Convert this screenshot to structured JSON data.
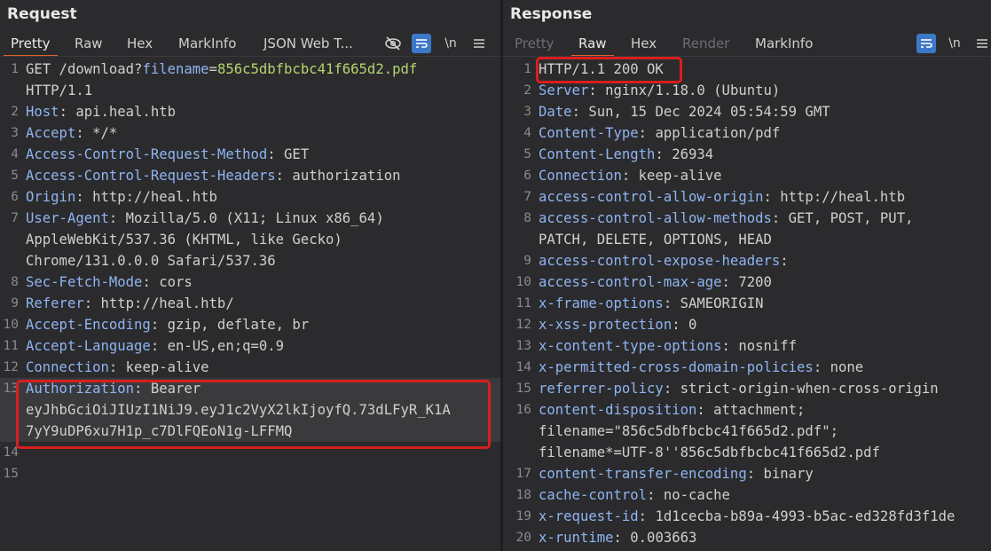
{
  "request": {
    "title": "Request",
    "tabs": [
      "Pretty",
      "Raw",
      "Hex",
      "MarkInfo",
      "JSON Web T..."
    ],
    "active_tab": "Pretty",
    "lines": [
      {
        "n": "1",
        "key": "GET /download?",
        "param": "filename",
        "eq": "=",
        "pval": "856c5dbfbcbc41f665d2.pdf",
        "rest": ""
      },
      {
        "n": "",
        "text": "HTTP/1.1"
      },
      {
        "n": "2",
        "key": "Host",
        "val": ": api.heal.htb"
      },
      {
        "n": "3",
        "key": "Accept",
        "val": ": */*"
      },
      {
        "n": "4",
        "key": "Access-Control-Request-Method",
        "val": ": GET"
      },
      {
        "n": "5",
        "key": "Access-Control-Request-Headers",
        "val": ": authorization"
      },
      {
        "n": "6",
        "key": "Origin",
        "val": ": http://heal.htb"
      },
      {
        "n": "7",
        "key": "User-Agent",
        "val": ": Mozilla/5.0 (X11; Linux x86_64)"
      },
      {
        "n": "",
        "text": "AppleWebKit/537.36 (KHTML, like Gecko)"
      },
      {
        "n": "",
        "text": "Chrome/131.0.0.0 Safari/537.36"
      },
      {
        "n": "8",
        "key": "Sec-Fetch-Mode",
        "val": ": cors"
      },
      {
        "n": "9",
        "key": "Referer",
        "val": ": http://heal.htb/"
      },
      {
        "n": "10",
        "key": "Accept-Encoding",
        "val": ": gzip, deflate, br"
      },
      {
        "n": "11",
        "key": "Accept-Language",
        "val": ": en-US,en;q=0.9"
      },
      {
        "n": "12",
        "key": "Connection",
        "val": ": keep-alive"
      },
      {
        "n": "13",
        "key": "Authorization",
        "val": ": Bearer"
      },
      {
        "n": "",
        "text": "eyJhbGciOiJIUzI1NiJ9.eyJ1c2VyX2lkIjoyfQ.73dLFyR_K1A"
      },
      {
        "n": "",
        "text": "7yY9uDP6xu7H1p_c7DlFQEoN1g-LFFMQ"
      },
      {
        "n": "14",
        "text": ""
      },
      {
        "n": "15",
        "text": ""
      }
    ]
  },
  "response": {
    "title": "Response",
    "tabs": [
      "Pretty",
      "Raw",
      "Hex",
      "Render",
      "MarkInfo"
    ],
    "active_tab": "Raw",
    "lines": [
      {
        "n": "1",
        "text": "HTTP/1.1 200 OK"
      },
      {
        "n": "2",
        "key": "Server",
        "val": ": nginx/1.18.0 (Ubuntu)"
      },
      {
        "n": "3",
        "key": "Date",
        "val": ": Sun, 15 Dec 2024 05:54:59 GMT"
      },
      {
        "n": "4",
        "key": "Content-Type",
        "val": ": application/pdf"
      },
      {
        "n": "5",
        "key": "Content-Length",
        "val": ": 26934"
      },
      {
        "n": "6",
        "key": "Connection",
        "val": ": keep-alive"
      },
      {
        "n": "7",
        "key": "access-control-allow-origin",
        "val": ": http://heal.htb"
      },
      {
        "n": "8",
        "key": "access-control-allow-methods",
        "val": ": GET, POST, PUT,"
      },
      {
        "n": "",
        "text": "PATCH, DELETE, OPTIONS, HEAD"
      },
      {
        "n": "9",
        "key": "access-control-expose-headers",
        "val": ":"
      },
      {
        "n": "10",
        "key": "access-control-max-age",
        "val": ": 7200"
      },
      {
        "n": "11",
        "key": "x-frame-options",
        "val": ": SAMEORIGIN"
      },
      {
        "n": "12",
        "key": "x-xss-protection",
        "val": ": 0"
      },
      {
        "n": "13",
        "key": "x-content-type-options",
        "val": ": nosniff"
      },
      {
        "n": "14",
        "key": "x-permitted-cross-domain-policies",
        "val": ": none"
      },
      {
        "n": "15",
        "key": "referrer-policy",
        "val": ": strict-origin-when-cross-origin"
      },
      {
        "n": "16",
        "key": "content-disposition",
        "val": ": attachment;"
      },
      {
        "n": "",
        "text": "filename=\"856c5dbfbcbc41f665d2.pdf\";"
      },
      {
        "n": "",
        "text": "filename*=UTF-8''856c5dbfbcbc41f665d2.pdf"
      },
      {
        "n": "17",
        "key": "content-transfer-encoding",
        "val": ": binary"
      },
      {
        "n": "18",
        "key": "cache-control",
        "val": ": no-cache"
      },
      {
        "n": "19",
        "key": "x-request-id",
        "val": ": 1d1cecba-b89a-4993-b5ac-ed328fd3f1de"
      },
      {
        "n": "20",
        "key": "x-runtime",
        "val": ": 0.003663"
      }
    ]
  },
  "toolbar": {
    "hide_icon": "eye-off-icon",
    "wrap_icon": "word-wrap-icon",
    "newline_label": "\\n",
    "menu_icon": "hamburger-menu-icon"
  },
  "colors": {
    "accent": "#e0622b",
    "highlight_box": "#d81e1e",
    "header_key": "#8fb4f2",
    "param_value": "#b5d46f",
    "button_blue": "#3c78c8"
  }
}
